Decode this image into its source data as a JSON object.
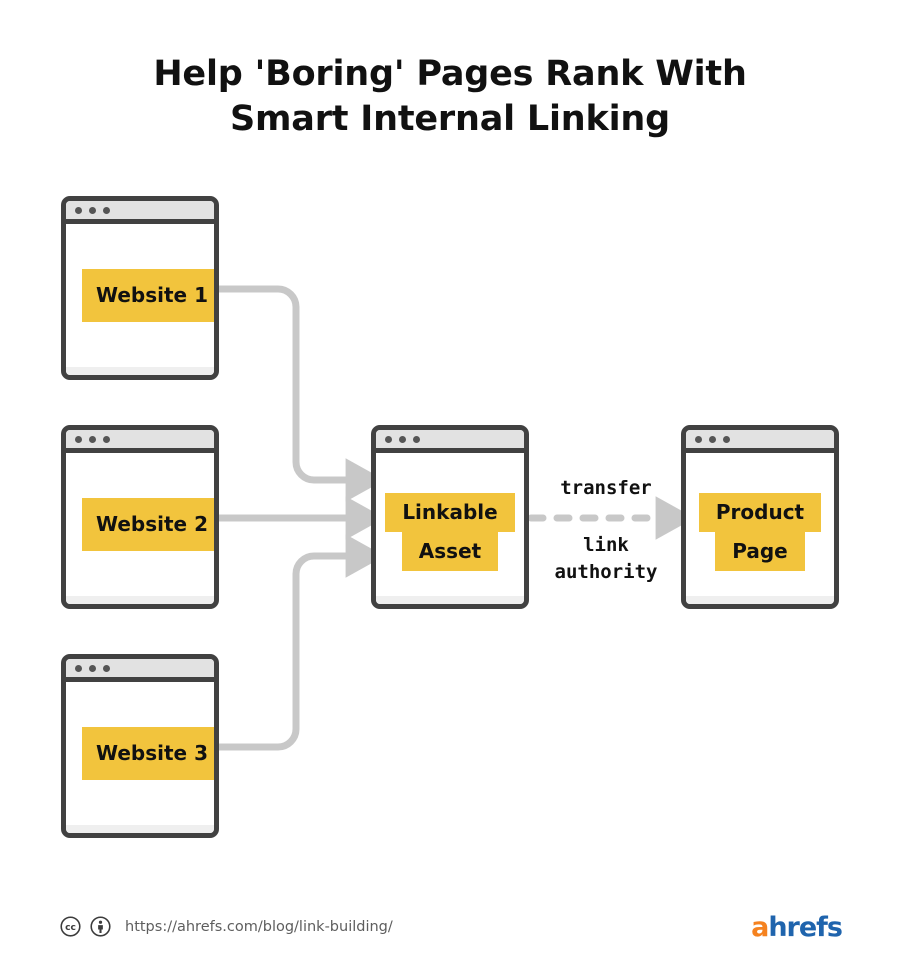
{
  "title": {
    "line1": "Help 'Boring' Pages Rank With",
    "line2": "Smart Internal Linking"
  },
  "diagram": {
    "type": "flow-diagram",
    "sources": [
      {
        "id": "website-1",
        "label": "Website 1"
      },
      {
        "id": "website-2",
        "label": "Website 2"
      },
      {
        "id": "website-3",
        "label": "Website 3"
      }
    ],
    "hub": {
      "id": "linkable-asset",
      "label_line1": "Linkable",
      "label_line2": "Asset"
    },
    "target": {
      "id": "product-page",
      "label_line1": "Product",
      "label_line2": "Page"
    },
    "transfer_edge": {
      "label_above": "transfer",
      "label_below": "link\nauthority",
      "style": "dashed"
    },
    "colors": {
      "highlight": "#f2c43d",
      "window_border": "#414141",
      "window_titlebar": "#e2e2e2",
      "connector": "#c8c8c8",
      "text": "#111111"
    }
  },
  "footer": {
    "license_icons": [
      "creative-commons-icon",
      "creative-commons-by-icon"
    ],
    "url": "https://ahrefs.com/blog/link-building/",
    "logo": {
      "accent": "a",
      "rest": "hrefs"
    }
  }
}
